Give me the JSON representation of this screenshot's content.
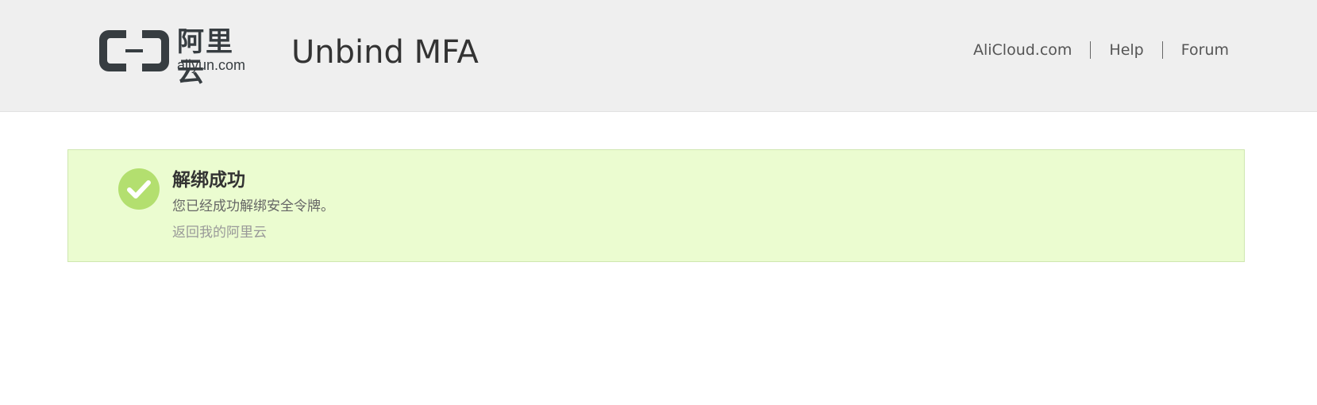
{
  "header": {
    "logo": {
      "cn": "阿里云",
      "en": "aliyun.com"
    },
    "title": "Unbind MFA",
    "nav": [
      {
        "label": "AliCloud.com"
      },
      {
        "label": "Help"
      },
      {
        "label": "Forum"
      }
    ]
  },
  "alert": {
    "icon": "check-circle-icon",
    "status_color": "#b3df6f",
    "background": "#ebfcd0",
    "title": "解绑成功",
    "message": "您已经成功解绑安全令牌。",
    "link": "返回我的阿里云"
  }
}
